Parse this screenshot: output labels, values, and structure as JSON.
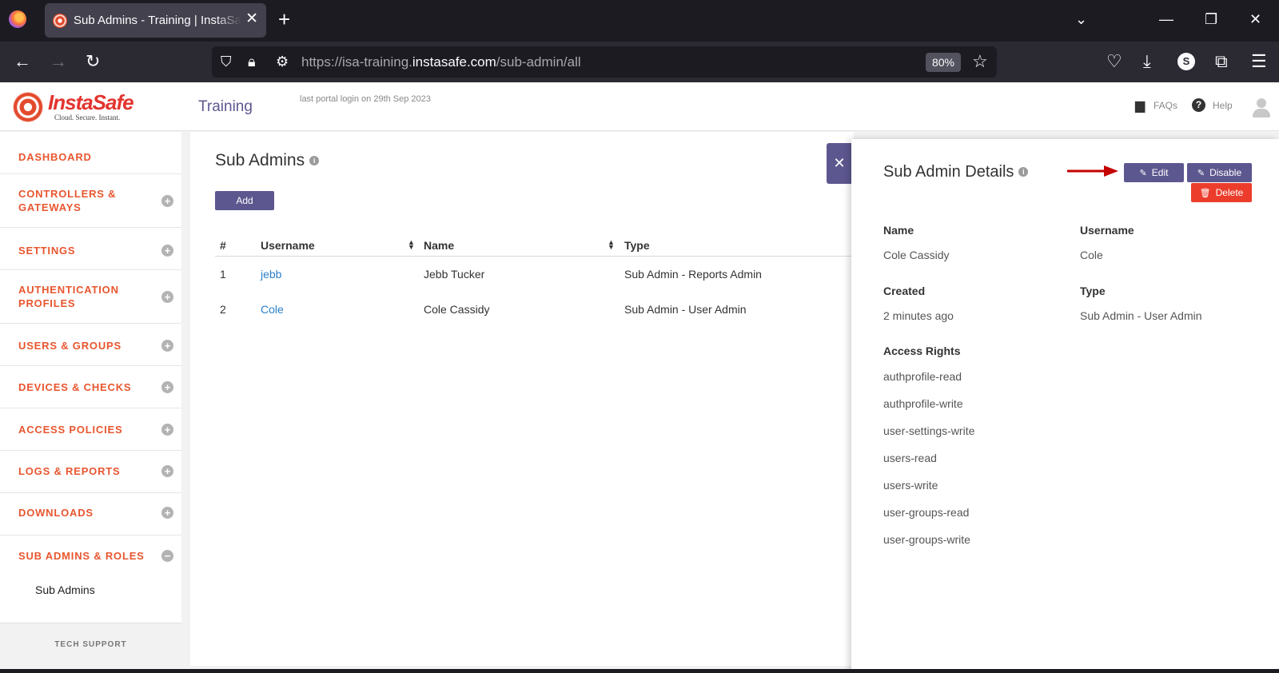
{
  "browser": {
    "tab_title": "Sub Admins - Training | InstaSafe",
    "url_prefix": "https://isa-training.",
    "url_domain": "instasafe.com",
    "url_path": "/sub-admin/all",
    "zoom": "80%",
    "profile_initial": "S"
  },
  "header": {
    "logo_text": "InstaSafe",
    "logo_tagline": "Cloud. Secure. Instant.",
    "portal_title": "Training",
    "last_login": "last portal login on 29th Sep 2023",
    "faqs": "FAQs",
    "help": "Help"
  },
  "sidebar": {
    "items": [
      {
        "label": "DASHBOARD"
      },
      {
        "label": "CONTROLLERS &",
        "label2": "GATEWAYS"
      },
      {
        "label": "SETTINGS"
      },
      {
        "label": "AUTHENTICATION",
        "label2": "PROFILES"
      },
      {
        "label": "USERS & GROUPS"
      },
      {
        "label": "DEVICES & CHECKS"
      },
      {
        "label": "ACCESS POLICIES"
      },
      {
        "label": "LOGS & REPORTS"
      },
      {
        "label": "DOWNLOADS"
      },
      {
        "label": "SUB ADMINS & ROLES"
      }
    ],
    "sub_item": "Sub Admins",
    "tech_support": "TECH SUPPORT"
  },
  "main": {
    "title": "Sub Admins",
    "add_label": "Add",
    "columns": [
      "#",
      "Username",
      "Name",
      "Type"
    ],
    "rows": [
      {
        "num": "1",
        "username": "jebb",
        "name": "Jebb Tucker",
        "type": "Sub Admin - Reports Admin"
      },
      {
        "num": "2",
        "username": "Cole",
        "name": "Cole Cassidy",
        "type": "Sub Admin - User Admin"
      }
    ]
  },
  "details": {
    "title": "Sub Admin Details",
    "edit_label": "Edit",
    "disable_label": "Disable",
    "delete_label": "Delete",
    "name_label": "Name",
    "name_value": "Cole Cassidy",
    "username_label": "Username",
    "username_value": "Cole",
    "created_label": "Created",
    "created_value": "2 minutes ago",
    "type_label": "Type",
    "type_value": "Sub Admin - User Admin",
    "rights_label": "Access Rights",
    "rights": [
      "authprofile-read",
      "authprofile-write",
      "user-settings-write",
      "users-read",
      "users-write",
      "user-groups-read",
      "user-groups-write"
    ]
  },
  "colors": {
    "brand_purple": "#5d578f",
    "nav_orange": "#e8562f",
    "delete_red": "#ec3d2c",
    "link_blue": "#2a7fc9"
  }
}
